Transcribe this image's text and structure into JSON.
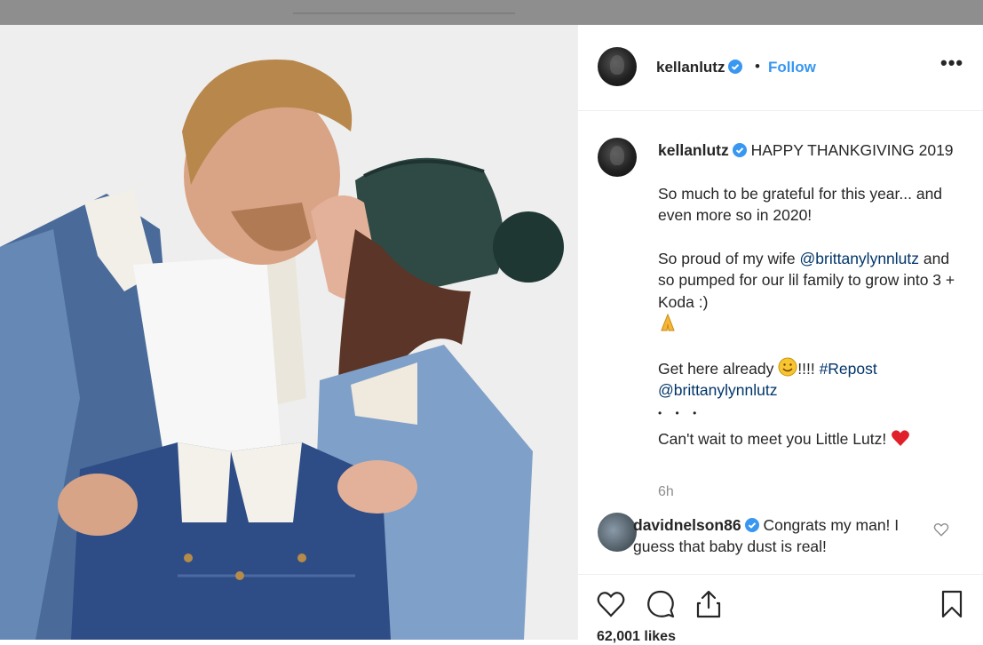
{
  "post": {
    "username": "kellanlutz",
    "follow_label": "Follow",
    "separator": "•",
    "more_label": "•••"
  },
  "caption": {
    "username": "kellanlutz",
    "line1": "HAPPY THANKGIVING 2019",
    "para2": "So much to be grateful for this year... and even more so in 2020!",
    "para3_a": "So proud of my wife",
    "para3_mention": "@brittanylynnlutz",
    "para3_b": "and so pumped for our lil family to grow into 3 + Koda :)",
    "para4_a": "Get here already",
    "para4_b": "!!!!",
    "para4_hashtag": "#Repost",
    "para4_mention": "@brittanylynnlutz",
    "dots": "• • •",
    "para5": "Can't wait to meet you Little Lutz!",
    "time": "6h"
  },
  "comment": {
    "username": "davidnelson86",
    "text": "Congrats my man! I guess that baby dust is real!"
  },
  "likes": "62,001 likes",
  "icons": [
    "verified-badge-icon",
    "more-options-icon",
    "heart-icon",
    "comment-icon",
    "share-icon",
    "bookmark-icon",
    "pray-emoji-icon",
    "smile-emoji-icon",
    "red-heart-emoji-icon"
  ],
  "colors": {
    "link": "#003569",
    "follow": "#3897f0",
    "verified": "#3897f0",
    "text": "#262626",
    "muted": "#8e8e8e"
  }
}
